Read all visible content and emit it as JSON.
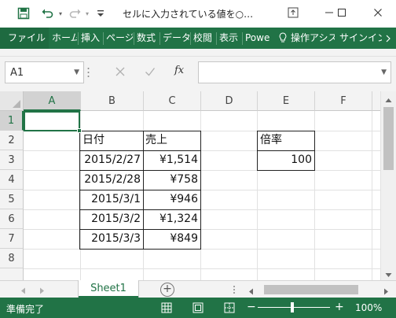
{
  "title_bar": {
    "title": "セルに入力されている値を○…",
    "icons": [
      "save-icon",
      "undo-icon",
      "redo-icon",
      "customize-quick-access-icon",
      "ribbon-display-options-icon",
      "minimize-icon",
      "maximize-icon",
      "close-icon"
    ]
  },
  "ribbon": {
    "tabs": [
      "ファイル",
      "ホーム",
      "挿入",
      "ページ",
      "数式",
      "データ",
      "校閲",
      "表示",
      "Powe",
      "操作アシス",
      "サインイン"
    ],
    "search_icon": "lightbulb-icon",
    "scroll_icon": "chevron-right-icon"
  },
  "formula_bar": {
    "name_box": "A1",
    "formula": "",
    "fx_label": "fx"
  },
  "grid": {
    "columns": [
      "A",
      "B",
      "C",
      "D",
      "E",
      "F"
    ],
    "rows": [
      "1",
      "2",
      "3",
      "4",
      "5",
      "6",
      "7",
      "8"
    ],
    "active_cell": "A1",
    "cells": {
      "B2": "日付",
      "C2": "売上",
      "B3": "2015/2/27",
      "C3": "¥1,514",
      "B4": "2015/2/28",
      "C4": "¥758",
      "B5": "2015/3/1",
      "C5": "¥946",
      "B6": "2015/3/2",
      "C6": "¥1,324",
      "B7": "2015/3/3",
      "C7": "¥849",
      "E2": "倍率",
      "E3": "100"
    }
  },
  "sheet_tabs": {
    "tabs": [
      "Sheet1"
    ],
    "add_label": "+"
  },
  "status_bar": {
    "status": "準備完了",
    "zoom_minus": "−",
    "zoom_plus": "+",
    "zoom": "100%"
  },
  "colors": {
    "accent": "#217346"
  }
}
